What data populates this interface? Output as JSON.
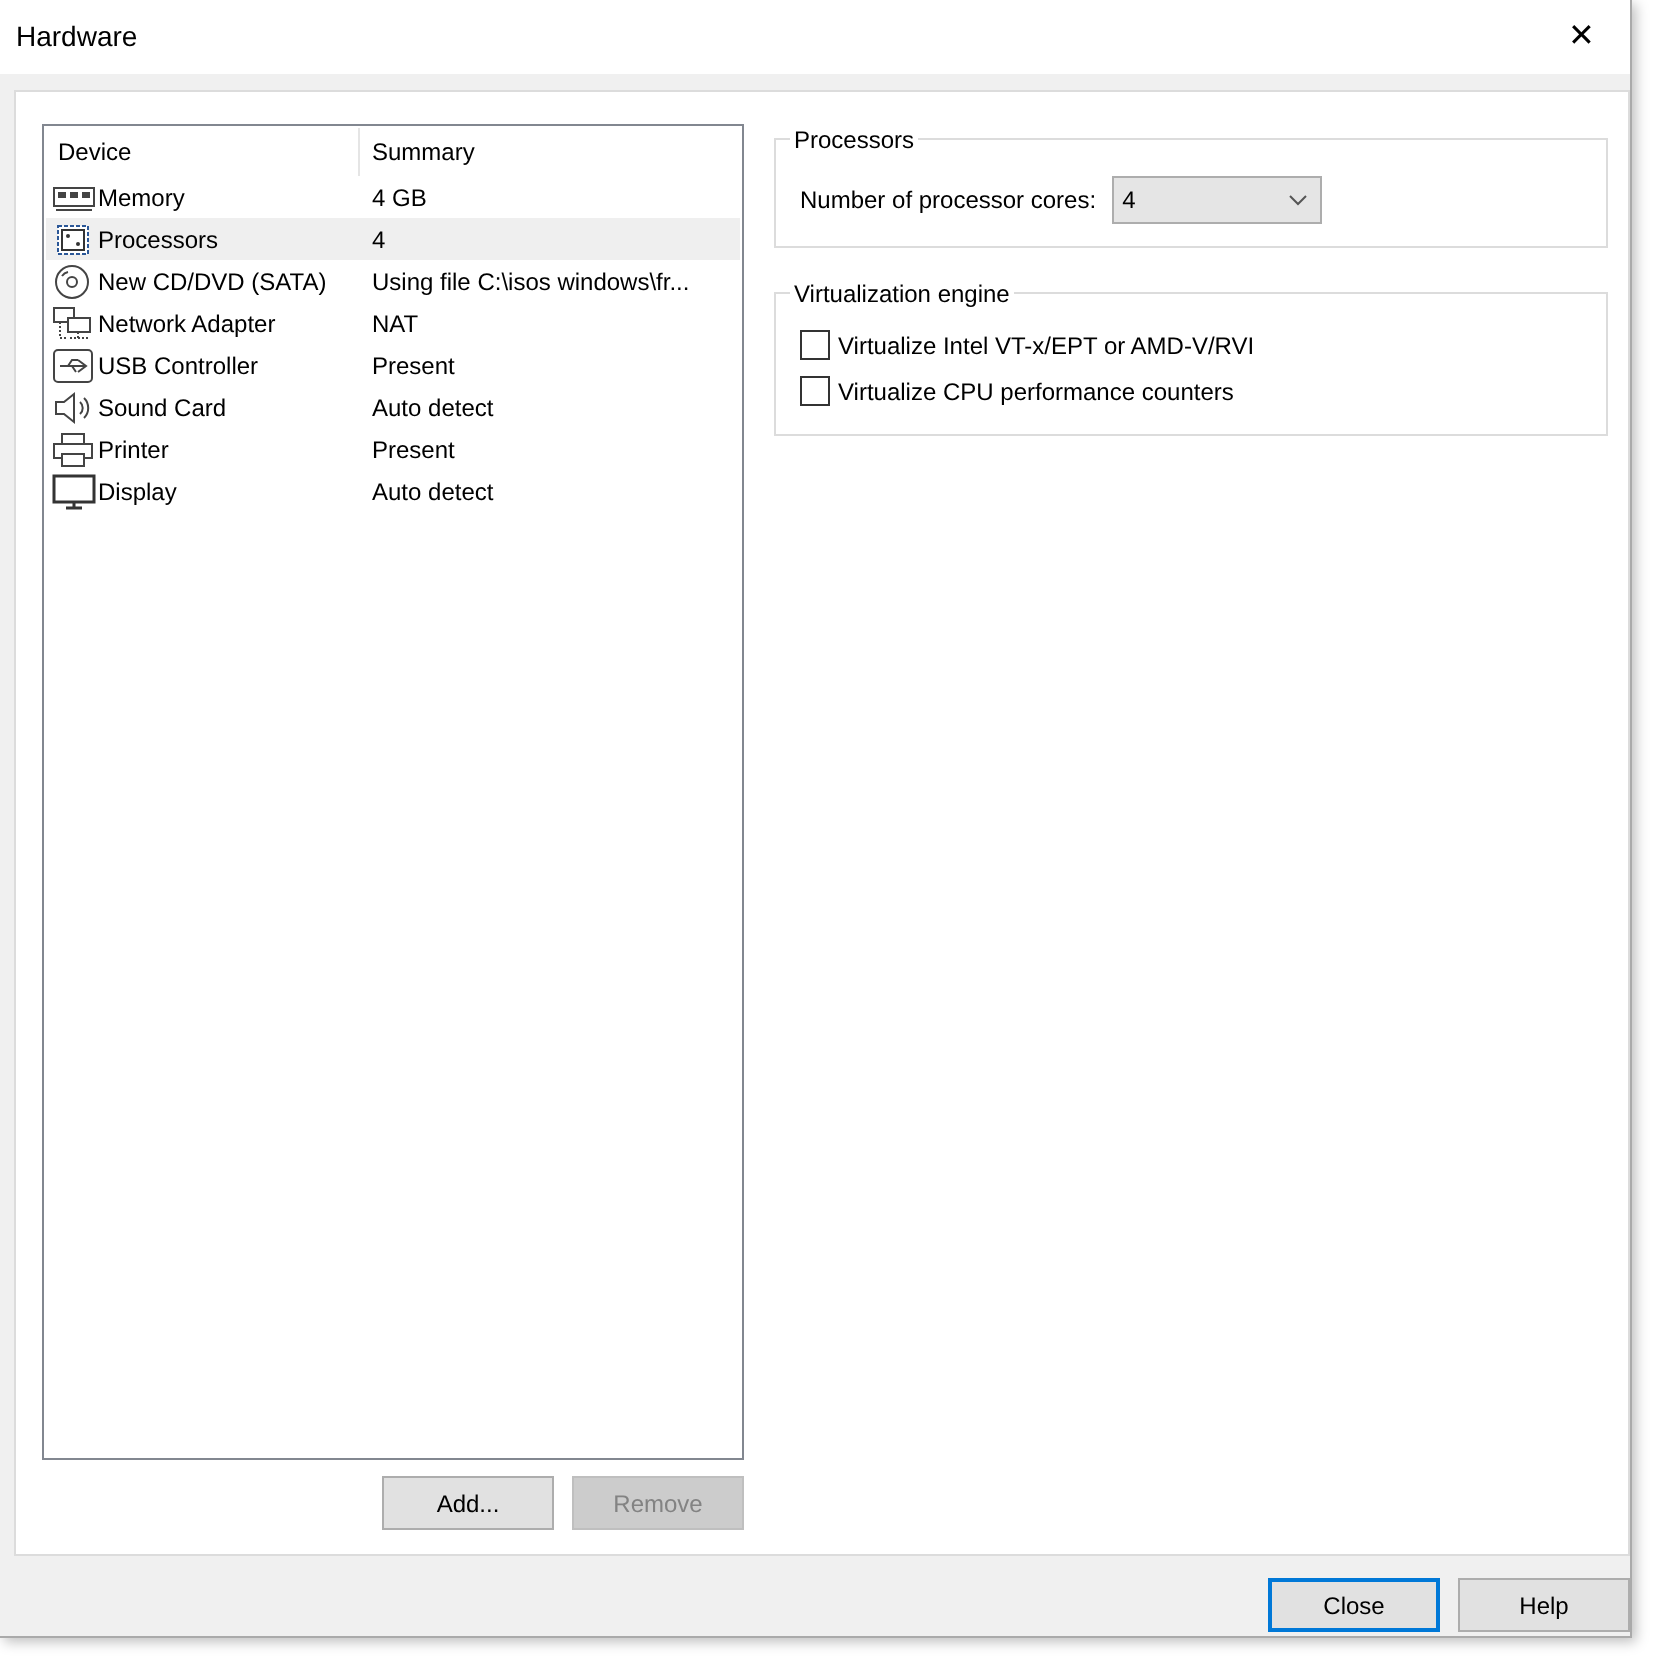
{
  "window": {
    "title": "Hardware",
    "close_glyph": "✕"
  },
  "device_table": {
    "columns": [
      "Device",
      "Summary"
    ],
    "rows": [
      {
        "device": "Memory",
        "summary": "4 GB",
        "selected": false
      },
      {
        "device": "Processors",
        "summary": "4",
        "selected": true
      },
      {
        "device": "New CD/DVD (SATA)",
        "summary": "Using file C:\\isos windows\\fr...",
        "selected": false
      },
      {
        "device": "Network Adapter",
        "summary": "NAT",
        "selected": false
      },
      {
        "device": "USB Controller",
        "summary": "Present",
        "selected": false
      },
      {
        "device": "Sound Card",
        "summary": "Auto detect",
        "selected": false
      },
      {
        "device": "Printer",
        "summary": "Present",
        "selected": false
      },
      {
        "device": "Display",
        "summary": "Auto detect",
        "selected": false
      }
    ]
  },
  "list_buttons": [
    {
      "label": "Add...",
      "disabled": false
    },
    {
      "label": "Remove",
      "disabled": true
    }
  ],
  "processors": {
    "title": "Processors",
    "cores_label": "Number of processor cores:",
    "cores_value": "4"
  },
  "virtualization": {
    "title": "Virtualization engine",
    "options": [
      {
        "label": "Virtualize Intel VT-x/EPT or AMD-V/RVI",
        "checked": false
      },
      {
        "label": "Virtualize CPU performance counters",
        "checked": false
      }
    ]
  },
  "footer_buttons": [
    {
      "label": "Close",
      "focused": true
    },
    {
      "label": "Help",
      "focused": false
    }
  ]
}
